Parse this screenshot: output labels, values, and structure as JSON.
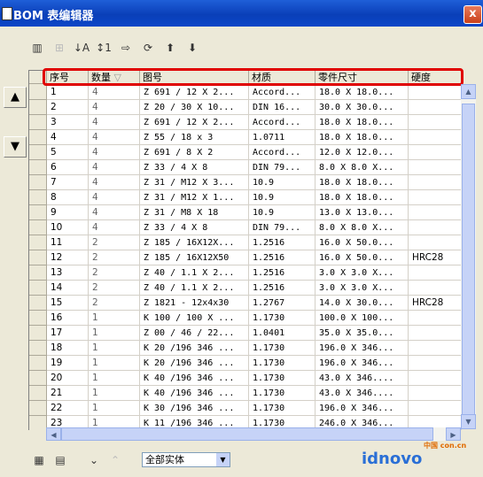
{
  "window": {
    "title": "BOM 表编辑器",
    "close_label": "x"
  },
  "columns": [
    "序号",
    "数量",
    "图号",
    "材质",
    "零件尺寸",
    "硬度"
  ],
  "sort_indicator": "▽",
  "rows": [
    [
      "1",
      "4",
      "Z 691 / 12 X 2...",
      "Accord...",
      "18.0 X 18.0...",
      ""
    ],
    [
      "2",
      "4",
      "Z 20 / 30 X 10...",
      "DIN 16...",
      "30.0 X 30.0...",
      ""
    ],
    [
      "3",
      "4",
      "Z 691 / 12 X 2...",
      "Accord...",
      "18.0 X 18.0...",
      ""
    ],
    [
      "4",
      "4",
      "Z 55 / 18 x 3",
      "1.0711",
      "18.0 X 18.0...",
      ""
    ],
    [
      "5",
      "4",
      "Z 691 / 8 X 2",
      "Accord...",
      "12.0 X 12.0...",
      ""
    ],
    [
      "6",
      "4",
      "Z 33 / 4 X 8",
      "DIN 79...",
      "8.0 X 8.0 X...",
      ""
    ],
    [
      "7",
      "4",
      "Z 31 / M12 X 3...",
      "10.9",
      "18.0 X 18.0...",
      ""
    ],
    [
      "8",
      "4",
      "Z 31 / M12 X 1...",
      "10.9",
      "18.0 X 18.0...",
      ""
    ],
    [
      "9",
      "4",
      "Z 31 / M8 X 18",
      "10.9",
      "13.0 X 13.0...",
      ""
    ],
    [
      "10",
      "4",
      "Z 33 / 4 X 8",
      "DIN 79...",
      "8.0 X 8.0 X...",
      ""
    ],
    [
      "11",
      "2",
      "Z 185 / 16X12X...",
      "1.2516",
      "16.0 X 50.0...",
      ""
    ],
    [
      "12",
      "2",
      "Z 185 / 16X12X50",
      "1.2516",
      "16.0 X 50.0...",
      "HRC28"
    ],
    [
      "13",
      "2",
      "Z 40 / 1.1 X 2...",
      "1.2516",
      "3.0 X 3.0 X...",
      ""
    ],
    [
      "14",
      "2",
      "Z 40 / 1.1 X 2...",
      "1.2516",
      "3.0 X 3.0 X...",
      ""
    ],
    [
      "15",
      "2",
      "Z 1821 - 12x4x30",
      "1.2767",
      "14.0 X 30.0...",
      "HRC28"
    ],
    [
      "16",
      "1",
      "K 100 / 100 X ...",
      "1.1730",
      "100.0 X 100...",
      ""
    ],
    [
      "17",
      "1",
      "Z 00 / 46 / 22...",
      "1.0401",
      "35.0 X 35.0...",
      ""
    ],
    [
      "18",
      "1",
      "K 20 /196 346 ...",
      "1.1730",
      "196.0 X 346...",
      ""
    ],
    [
      "19",
      "1",
      "K 20 /196 346 ...",
      "1.1730",
      "196.0 X 346...",
      ""
    ],
    [
      "20",
      "1",
      "K 40 /196 346 ...",
      "1.1730",
      "43.0 X 346....",
      ""
    ],
    [
      "21",
      "1",
      "K 40 /196 346 ...",
      "1.1730",
      "43.0 X 346....",
      ""
    ],
    [
      "22",
      "1",
      "K 30 /196 346 ...",
      "1.1730",
      "196.0 X 346...",
      ""
    ],
    [
      "23",
      "1",
      "K 11 /196 346 ...",
      "1.1730",
      "246.0 X 346...",
      ""
    ]
  ],
  "toolbar_icons": [
    "bom-columns-icon",
    "tree-icon",
    "sort-az-icon",
    "sort-numbers-icon",
    "export-icon",
    "refresh-link-icon",
    "import-user-icon",
    "download-user-icon"
  ],
  "side_buttons": {
    "up": "▲",
    "down": "▼"
  },
  "bottom": {
    "filter_value": "全部实体",
    "watermark": "idnovo",
    "watermark_small": "中国 con.cn"
  }
}
